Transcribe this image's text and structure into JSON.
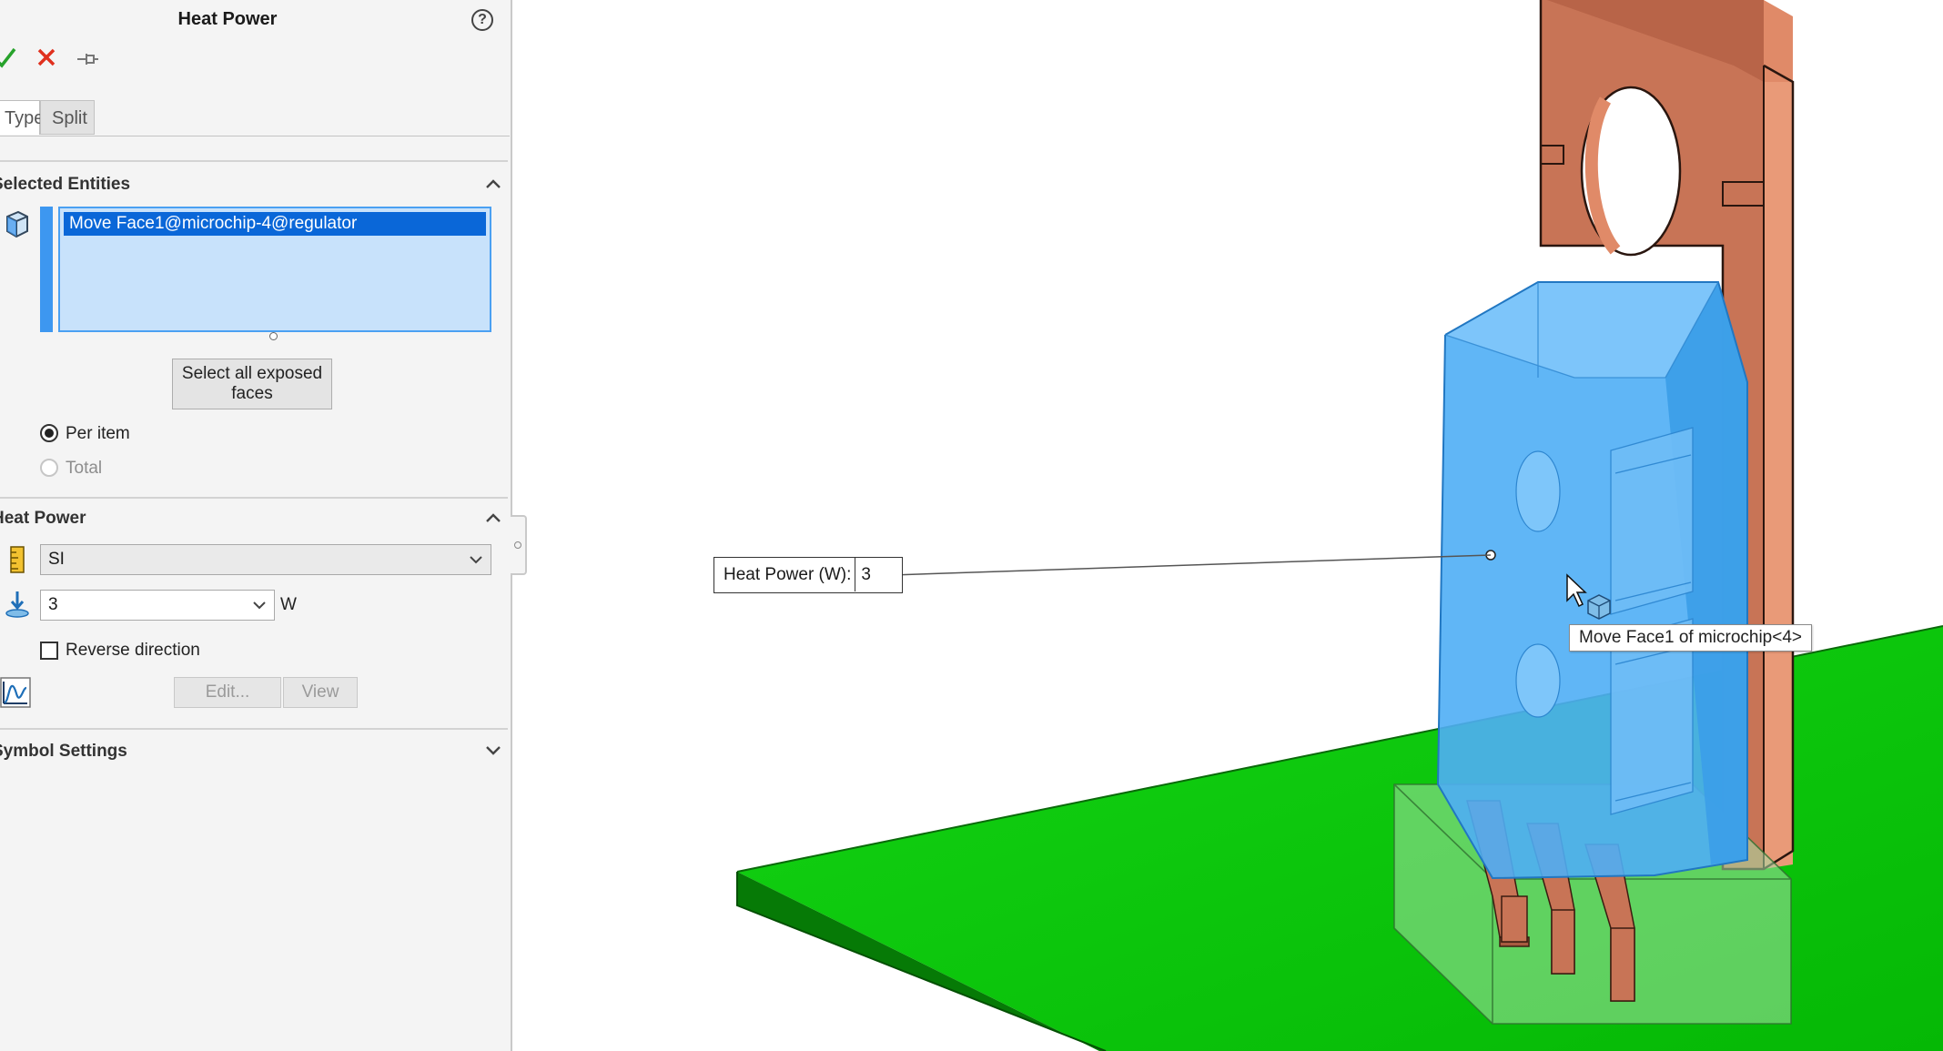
{
  "panel": {
    "title": "Heat Power",
    "toolbar": {
      "ok_icon": "checkmark-icon",
      "cancel_icon": "x-icon",
      "pin_icon": "pushpin-icon",
      "help_glyph": "?"
    },
    "tabs": [
      {
        "label": "Type",
        "active": true
      },
      {
        "label": "Split",
        "active": false
      }
    ],
    "selected_entities": {
      "title": "Selected Entities",
      "items": [
        "Move Face1@microchip-4@regulator"
      ],
      "select_all_button": "Select all exposed faces",
      "options": [
        {
          "label": "Per item",
          "selected": true
        },
        {
          "label": "Total",
          "selected": false
        }
      ]
    },
    "heat_power": {
      "title": "Heat Power",
      "unit_system": "SI",
      "value": "3",
      "unit": "W",
      "reverse_direction_label": "Reverse direction",
      "reverse_direction_checked": false,
      "edit_button": "Edit...",
      "view_button": "View"
    },
    "symbol_settings": {
      "title": "Symbol Settings"
    }
  },
  "viewport": {
    "callout": {
      "label": "Heat Power (W):",
      "value": "3"
    },
    "tooltip": "Move Face1 of microchip<4>",
    "colors": {
      "board": "#0ac50a",
      "copper": "#c87456",
      "selected_face": "#4faef5",
      "package": "#a8e0a8"
    }
  }
}
